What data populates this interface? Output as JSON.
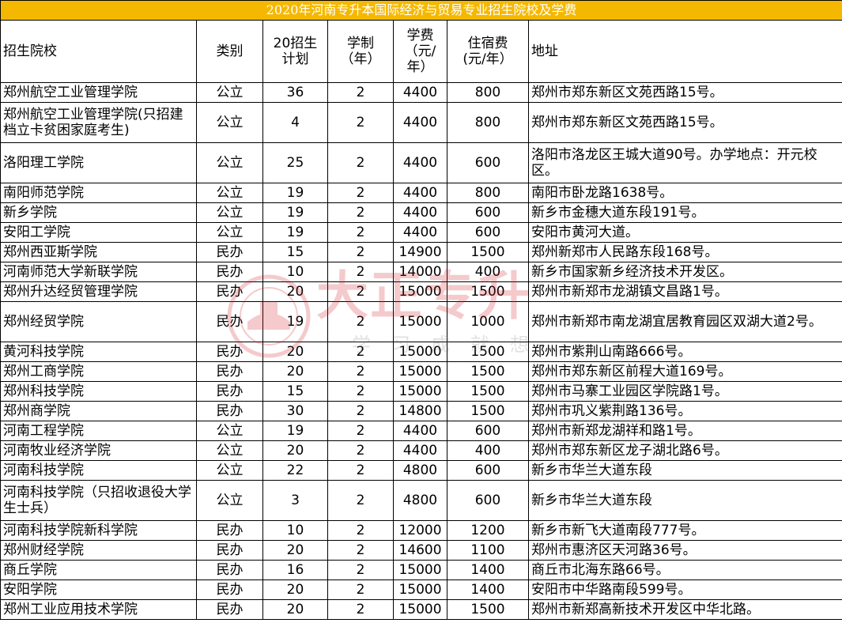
{
  "title": "2020年河南专升本国际经济与贸易专业招生院校及学费",
  "headers": {
    "school": "招生院校",
    "type": "类别",
    "plan": [
      "20招生",
      "计划"
    ],
    "duration": [
      "学制",
      "（年）"
    ],
    "tuition": [
      "学费",
      "（元/",
      "年）"
    ],
    "lodging": [
      "住宿费",
      "(元/年）"
    ],
    "address": "地址"
  },
  "rows": [
    {
      "school": "郑州航空工业管理学院",
      "type": "公立",
      "plan": "36",
      "years": "2",
      "tuition": "4400",
      "lodging": "800",
      "address": "郑州市郑东新区文苑西路15号。"
    },
    {
      "school": "郑州航空工业管理学院(只招建档立卡贫困家庭考生)",
      "type": "公立",
      "plan": "4",
      "years": "2",
      "tuition": "4400",
      "lodging": "800",
      "address": "郑州市郑东新区文苑西路15号。",
      "tall": true
    },
    {
      "school": "洛阳理工学院",
      "type": "公立",
      "plan": "25",
      "years": "2",
      "tuition": "4400",
      "lodging": "600",
      "address": "洛阳市洛龙区王城大道90号。办学地点：开元校区。",
      "tall": true
    },
    {
      "school": "南阳师范学院",
      "type": "公立",
      "plan": "19",
      "years": "2",
      "tuition": "4400",
      "lodging": "800",
      "address": "南阳市卧龙路1638号。"
    },
    {
      "school": "新乡学院",
      "type": "公立",
      "plan": "19",
      "years": "2",
      "tuition": "4400",
      "lodging": "600",
      "address": "新乡市金穗大道东段191号。"
    },
    {
      "school": "安阳工学院",
      "type": "公立",
      "plan": "19",
      "years": "2",
      "tuition": "4400",
      "lodging": "600",
      "address": "安阳市黄河大道。"
    },
    {
      "school": "郑州西亚斯学院",
      "type": "民办",
      "plan": "15",
      "years": "2",
      "tuition": "14900",
      "lodging": "1500",
      "address": "郑州新郑市人民路东段168号。"
    },
    {
      "school": "河南师范大学新联学院",
      "type": "民办",
      "plan": "10",
      "years": "2",
      "tuition": "14000",
      "lodging": "400",
      "address": "新乡市国家新乡经济技术开发区。"
    },
    {
      "school": "郑州升达经贸管理学院",
      "type": "民办",
      "plan": "20",
      "years": "2",
      "tuition": "15000",
      "lodging": "1500",
      "address": "郑州市新郑市龙湖镇文昌路1号。"
    },
    {
      "school": "郑州经贸学院",
      "type": "民办",
      "plan": "19",
      "years": "2",
      "tuition": "15000",
      "lodging": "1000",
      "address": "郑州市新郑市南龙湖宜居教育园区双湖大道2号。",
      "tall": true
    },
    {
      "school": "黄河科技学院",
      "type": "民办",
      "plan": "20",
      "years": "2",
      "tuition": "15000",
      "lodging": "1500",
      "address": "郑州市紫荆山南路666号。"
    },
    {
      "school": "郑州工商学院",
      "type": "民办",
      "plan": "20",
      "years": "2",
      "tuition": "15000",
      "lodging": "1500",
      "address": "郑州市郑东新区前程大道169号。"
    },
    {
      "school": "郑州科技学院",
      "type": "民办",
      "plan": "15",
      "years": "2",
      "tuition": "15000",
      "lodging": "1500",
      "address": "郑州市马寨工业园区学院路1号。"
    },
    {
      "school": "郑州商学院",
      "type": "民办",
      "plan": "30",
      "years": "2",
      "tuition": "14800",
      "lodging": "1500",
      "address": "郑州市巩义紫荆路136号。"
    },
    {
      "school": "河南工程学院",
      "type": "公立",
      "plan": "19",
      "years": "2",
      "tuition": "4400",
      "lodging": "600",
      "address": "郑州市新郑龙湖祥和路1号。"
    },
    {
      "school": "河南牧业经济学院",
      "type": "公立",
      "plan": "20",
      "years": "2",
      "tuition": "4400",
      "lodging": "400",
      "address": "郑州市郑东新区龙子湖北路6号。"
    },
    {
      "school": "河南科技学院",
      "type": "公立",
      "plan": "22",
      "years": "2",
      "tuition": "4800",
      "lodging": "600",
      "address": "新乡市华兰大道东段"
    },
    {
      "school": "河南科技学院（只招收退役大学生士兵）",
      "type": "公立",
      "plan": "3",
      "years": "2",
      "tuition": "4800",
      "lodging": "600",
      "address": "新乡市华兰大道东段",
      "tall": true
    },
    {
      "school": "河南科技学院新科学院",
      "type": "民办",
      "plan": "10",
      "years": "2",
      "tuition": "12000",
      "lodging": "1200",
      "address": "新乡市新飞大道南段777号。"
    },
    {
      "school": "郑州财经学院",
      "type": "民办",
      "plan": "20",
      "years": "2",
      "tuition": "14600",
      "lodging": "1100",
      "address": "郑州市惠济区天河路36号。"
    },
    {
      "school": "商丘学院",
      "type": "民办",
      "plan": "16",
      "years": "2",
      "tuition": "15000",
      "lodging": "1400",
      "address": "商丘市北海东路66号。"
    },
    {
      "school": "安阳学院",
      "type": "民办",
      "plan": "20",
      "years": "2",
      "tuition": "15000",
      "lodging": "1400",
      "address": "安阳市中华路南段599号。"
    },
    {
      "school": "郑州工业应用技术学院",
      "type": "民办",
      "plan": "20",
      "years": "2",
      "tuition": "15000",
      "lodging": "1500",
      "address": "郑州市新郑高新技术开发区中华北路。"
    }
  ],
  "watermark": {
    "brand": "大正专升",
    "slogan": [
      "学",
      "习",
      "成",
      "就",
      "想"
    ],
    "colors": {
      "brand": "#d0141b",
      "header": "#f5b800"
    }
  }
}
